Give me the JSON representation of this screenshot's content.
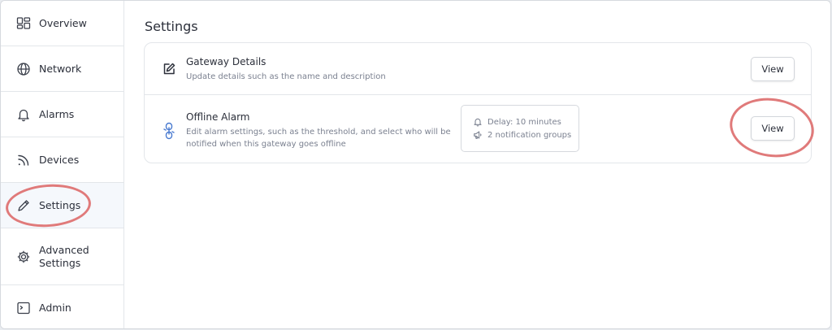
{
  "sidebar": {
    "items": [
      {
        "label": "Overview",
        "icon": "overview-icon"
      },
      {
        "label": "Network",
        "icon": "globe-icon"
      },
      {
        "label": "Alarms",
        "icon": "bell-icon"
      },
      {
        "label": "Devices",
        "icon": "rss-icon"
      },
      {
        "label": "Settings",
        "icon": "pencil-icon",
        "active": true
      },
      {
        "label": "Advanced Settings",
        "icon": "gear-icon"
      },
      {
        "label": "Admin",
        "icon": "terminal-icon"
      }
    ]
  },
  "main": {
    "title": "Settings",
    "rows": [
      {
        "title": "Gateway Details",
        "description": "Update details such as the name and description",
        "button": "View",
        "icon": "edit-icon"
      },
      {
        "title": "Offline Alarm",
        "description": "Edit alarm settings, such as the threshold, and select who will be notified when this gateway goes offline",
        "button": "View",
        "icon": "alarm-link-icon",
        "info": {
          "delay": "Delay: 10 minutes",
          "groups": "2 notification groups"
        }
      }
    ]
  },
  "colors": {
    "annotation": "#e07a7a",
    "accent": "#4a7bd0"
  }
}
